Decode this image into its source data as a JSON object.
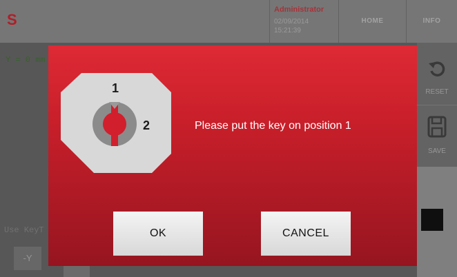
{
  "app": {
    "logo_letter": "S",
    "user": {
      "name": "Administrator",
      "date": "02/09/2014",
      "time": "15:21:39"
    },
    "nav": {
      "home_label": "HOME",
      "info_label": "INFO"
    }
  },
  "workspace": {
    "coordinate_text": "Y = 0 mm",
    "keyboard_hint": "Use KeyT",
    "minus_y_label": "-Y"
  },
  "sidebar": {
    "reset_label": "RESET",
    "save_label": "SAVE"
  },
  "dialog": {
    "position_labels": {
      "one": "1",
      "two": "2"
    },
    "message": "Please put the key on position 1",
    "ok_label": "OK",
    "cancel_label": "CANCEL"
  },
  "colors": {
    "accent_red": "#d2232e",
    "dialog_top": "#de2a35",
    "dialog_bottom": "#961520",
    "button_bg": "#ececec"
  }
}
